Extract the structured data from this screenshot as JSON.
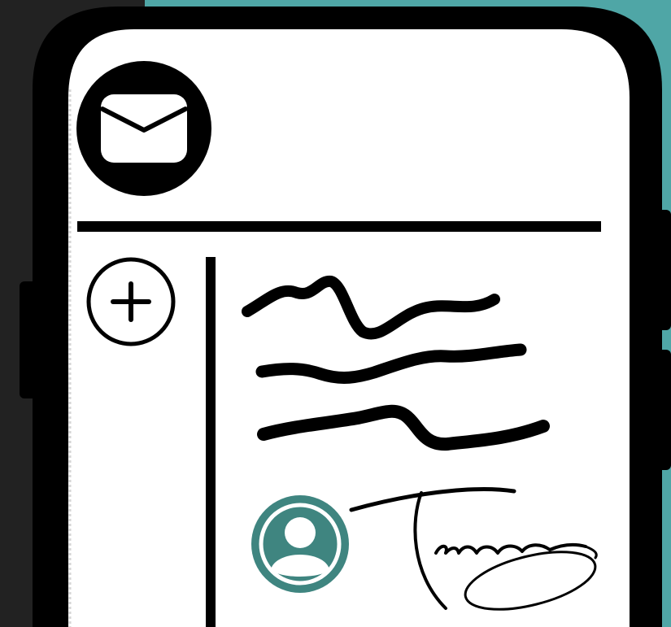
{
  "colors": {
    "backdrop_dark": "#222222",
    "backdrop_teal": "#4fa6a6",
    "phone_frame": "#000000",
    "screen": "#ffffff",
    "avatar_teal": "#3f8580"
  },
  "header": {
    "icon": "envelope-icon"
  },
  "sidebar": {
    "compose_icon": "plus-circle-icon"
  },
  "message": {
    "body_lines": 3,
    "avatar_icon": "user-avatar-icon",
    "signature_text": "Tamara"
  }
}
